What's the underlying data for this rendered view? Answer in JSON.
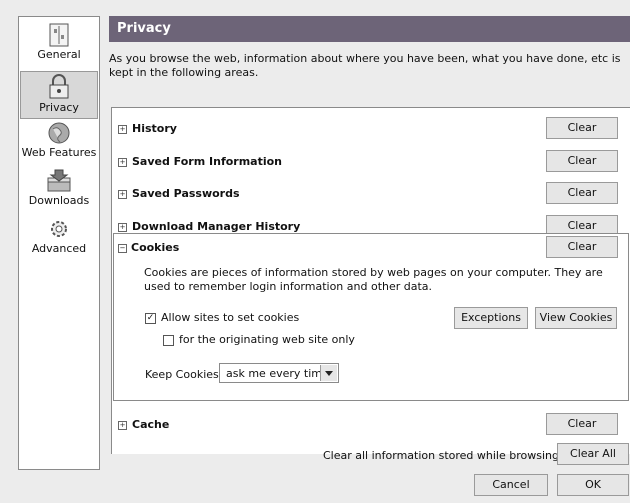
{
  "sidebar": {
    "items": [
      {
        "label": "General",
        "icon": "general-icon"
      },
      {
        "label": "Privacy",
        "icon": "lock-icon"
      },
      {
        "label": "Web Features",
        "icon": "globe-icon"
      },
      {
        "label": "Downloads",
        "icon": "downloads-icon"
      },
      {
        "label": "Advanced",
        "icon": "gear-icon"
      }
    ]
  },
  "header": {
    "title": "Privacy"
  },
  "intro": "As you browse the web, information about where you have been, what you have done, etc is kept in the following areas.",
  "sections": {
    "history": {
      "title": "History",
      "clear": "Clear"
    },
    "form": {
      "title": "Saved Form Information",
      "clear": "Clear"
    },
    "passwords": {
      "title": "Saved Passwords",
      "clear": "Clear"
    },
    "download": {
      "title": "Download Manager History",
      "clear": "Clear"
    },
    "cookies": {
      "title": "Cookies",
      "clear": "Clear",
      "description": "Cookies are pieces of information stored by web pages on your computer. They are used to remember login information and other data.",
      "allow_label": "Allow sites to set cookies",
      "allow_checked": true,
      "origin_label": "for the originating web site only",
      "origin_checked": false,
      "exceptions": "Exceptions",
      "view": "View Cookies",
      "keep_label": "Keep Cookies:",
      "keep_value": "ask me every time"
    },
    "cache": {
      "title": "Cache",
      "clear": "Clear"
    }
  },
  "footer": {
    "clear_all_label": "Clear all information stored while browsing:",
    "clear_all": "Clear All",
    "cancel": "Cancel",
    "ok": "OK"
  },
  "colors": {
    "header_bg": "#6d6478"
  }
}
